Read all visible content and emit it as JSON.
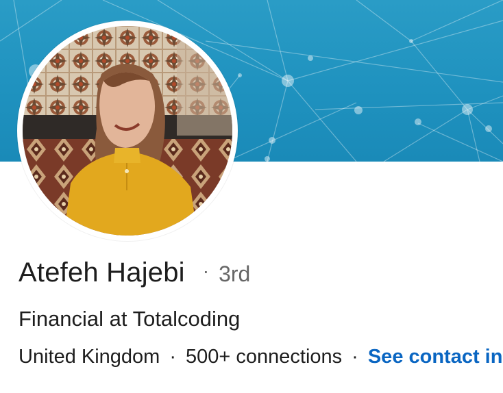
{
  "profile": {
    "name": "Atefeh Hajebi",
    "separator": "·",
    "degree": "3rd",
    "headline": "Financial at Totalcoding",
    "location": "United Kingdom",
    "connections": "500+ connections",
    "contact_link": "See contact info"
  },
  "colors": {
    "banner": "#1f92bf",
    "link": "#0a66c2",
    "text": "#1d1d1d",
    "muted": "#666666"
  },
  "icons": {
    "banner_pattern": "network-nodes",
    "avatar": "profile-photo"
  }
}
